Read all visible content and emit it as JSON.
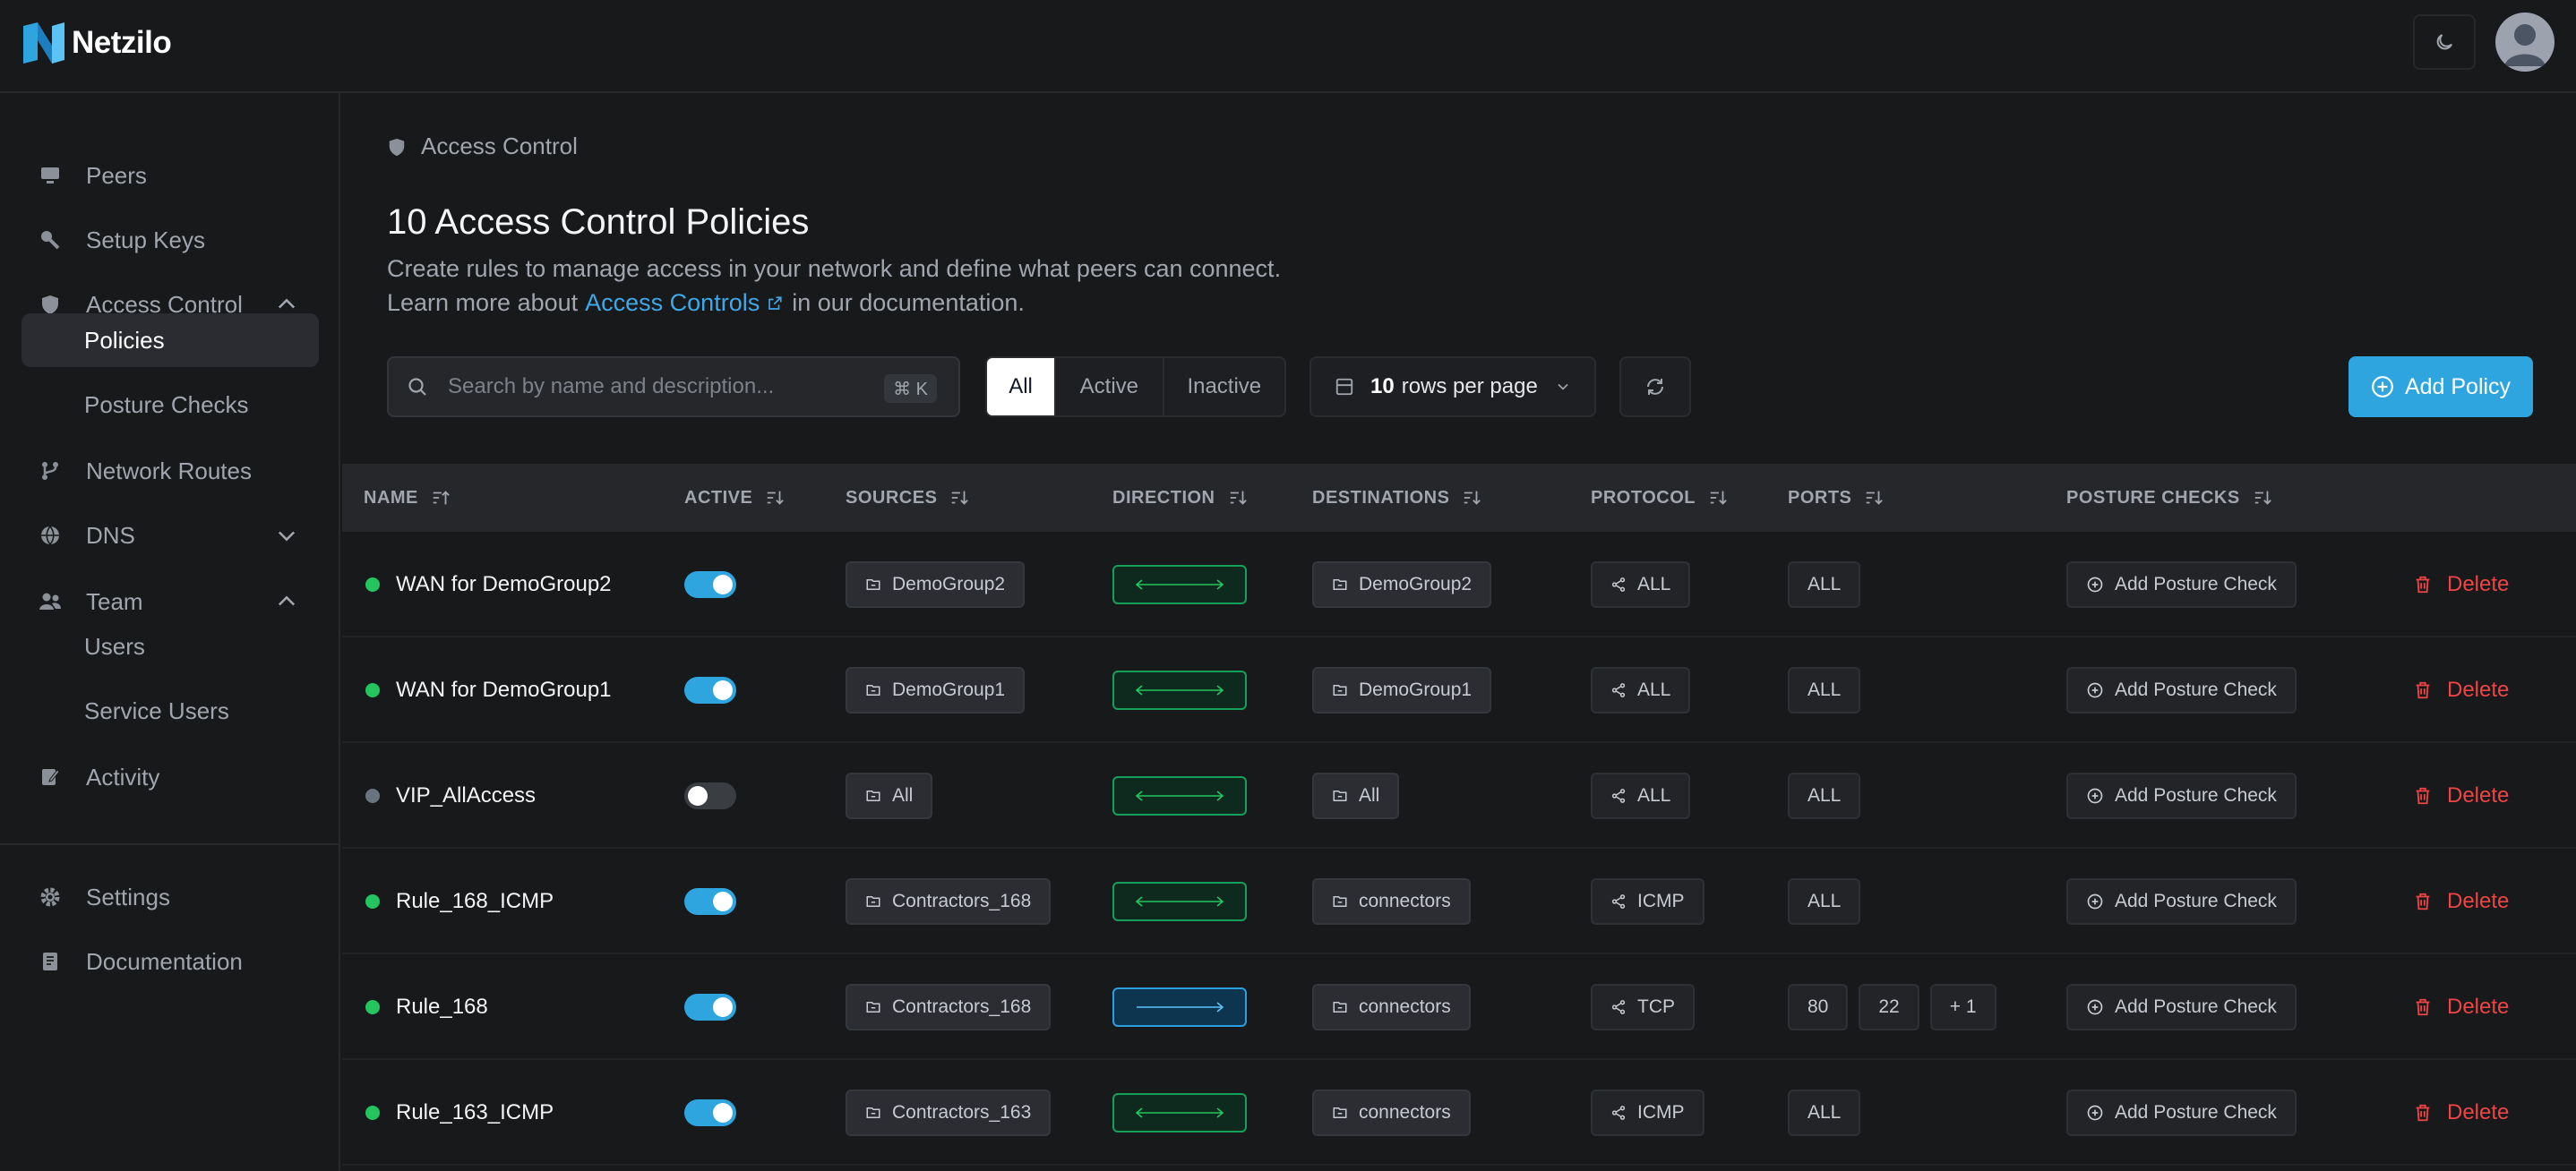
{
  "brand": {
    "name": "Netzilo"
  },
  "sidebar": {
    "items": [
      {
        "label": "Peers",
        "icon": "monitor-icon"
      },
      {
        "label": "Setup Keys",
        "icon": "key-icon"
      },
      {
        "label": "Access Control",
        "icon": "shield-icon"
      },
      {
        "label": "Network Routes",
        "icon": "route-icon"
      },
      {
        "label": "DNS",
        "icon": "globe-icon"
      },
      {
        "label": "Team",
        "icon": "users-icon"
      },
      {
        "label": "Activity",
        "icon": "activity-icon"
      },
      {
        "label": "Settings",
        "icon": "gear-icon"
      },
      {
        "label": "Documentation",
        "icon": "book-icon"
      }
    ],
    "access_sub": [
      "Policies",
      "Posture Checks"
    ],
    "team_sub": [
      "Users",
      "Service Users"
    ]
  },
  "breadcrumb": "Access Control",
  "page": {
    "title": "10 Access Control Policies",
    "desc_line1": "Create rules to manage access in your network and define what peers can connect.",
    "desc_prefix": "Learn more about",
    "desc_link": "Access Controls",
    "desc_suffix": "in our documentation."
  },
  "toolbar": {
    "search_placeholder": "Search by name and description...",
    "search_shortcut": "⌘ K",
    "filters": [
      "All",
      "Active",
      "Inactive"
    ],
    "active_filter": "All",
    "rows_count": "10",
    "rows_label": "rows per page",
    "add_label": "Add Policy"
  },
  "table": {
    "headers": [
      "NAME",
      "ACTIVE",
      "SOURCES",
      "DIRECTION",
      "DESTINATIONS",
      "PROTOCOL",
      "PORTS",
      "POSTURE CHECKS"
    ],
    "posture_label": "Add Posture Check",
    "delete_label": "Delete",
    "rows": [
      {
        "name": "WAN for DemoGroup2",
        "active": true,
        "source": "DemoGroup2",
        "direction": "bi",
        "destination": "DemoGroup2",
        "protocol": "ALL",
        "ports": [
          "ALL"
        ]
      },
      {
        "name": "WAN for DemoGroup1",
        "active": true,
        "source": "DemoGroup1",
        "direction": "bi",
        "destination": "DemoGroup1",
        "protocol": "ALL",
        "ports": [
          "ALL"
        ]
      },
      {
        "name": "VIP_AllAccess",
        "active": false,
        "source": "All",
        "direction": "bi",
        "destination": "All",
        "protocol": "ALL",
        "ports": [
          "ALL"
        ]
      },
      {
        "name": "Rule_168_ICMP",
        "active": true,
        "source": "Contractors_168",
        "direction": "bi",
        "destination": "connectors",
        "protocol": "ICMP",
        "ports": [
          "ALL"
        ]
      },
      {
        "name": "Rule_168",
        "active": true,
        "source": "Contractors_168",
        "direction": "uni",
        "destination": "connectors",
        "protocol": "TCP",
        "ports": [
          "80",
          "22",
          "+ 1"
        ]
      },
      {
        "name": "Rule_163_ICMP",
        "active": true,
        "source": "Contractors_163",
        "direction": "bi",
        "destination": "connectors",
        "protocol": "ICMP",
        "ports": [
          "ALL"
        ]
      }
    ]
  },
  "colors": {
    "accent": "#2fa5e0",
    "active_dot": "#22c55e",
    "inactive_dot": "#6b7280",
    "danger": "#ef4444",
    "bi_border": "#14a05a",
    "uni_border": "#2b9fe0"
  }
}
